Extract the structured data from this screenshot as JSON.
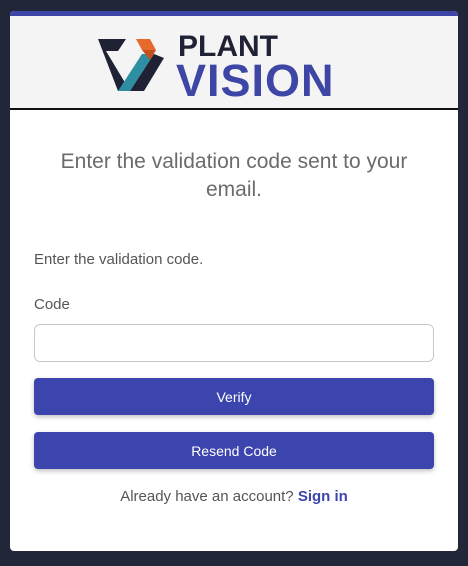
{
  "brand": {
    "line1": "PLANT",
    "line2": "VISION",
    "colors": {
      "navy": "#1f2235",
      "blue": "#3e46a5",
      "orange": "#e66a2c",
      "teal": "#2e8fa3"
    }
  },
  "form": {
    "heading": "Enter the validation code sent to your email.",
    "instruction": "Enter the validation code.",
    "code_label": "Code",
    "code_value": "",
    "verify_label": "Verify",
    "resend_label": "Resend Code"
  },
  "footer": {
    "prompt": "Already have an account?",
    "signin_label": "Sign in"
  }
}
